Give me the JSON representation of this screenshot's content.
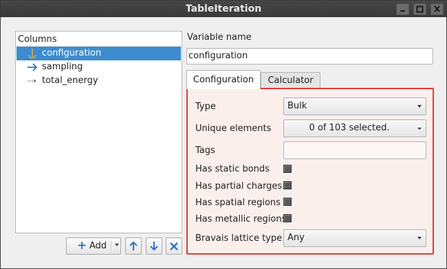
{
  "window": {
    "title": "TableIteration",
    "controls": [
      "minimize",
      "maximize",
      "close"
    ]
  },
  "columns_panel": {
    "header": "Columns",
    "items": [
      {
        "label": "configuration",
        "icon": "anchor-icon",
        "selected": true
      },
      {
        "label": "sampling",
        "icon": "arrow-right-icon",
        "selected": false
      },
      {
        "label": "total_energy",
        "icon": "dashed-arrow-icon",
        "selected": false
      }
    ]
  },
  "toolbar": {
    "add_label": "Add"
  },
  "variable": {
    "label": "Variable name",
    "value": "configuration"
  },
  "tabs": [
    {
      "label": "Configuration",
      "active": true
    },
    {
      "label": "Calculator",
      "active": false
    }
  ],
  "form": {
    "type": {
      "label": "Type",
      "value": "Bulk"
    },
    "unique_elements": {
      "label": "Unique elements",
      "value": "0 of 103 selected."
    },
    "tags": {
      "label": "Tags",
      "value": ""
    },
    "has_static_bonds": {
      "label": "Has static bonds",
      "checked": "indeterminate"
    },
    "has_partial_charges": {
      "label": "Has partial charges",
      "checked": "indeterminate"
    },
    "has_spatial_regions": {
      "label": "Has spatial regions",
      "checked": "indeterminate"
    },
    "has_metallic_regions": {
      "label": "Has metallic regions",
      "checked": "indeterminate"
    },
    "bravais": {
      "label": "Bravais lattice type",
      "value": "Any"
    }
  },
  "colors": {
    "selection": "#3d8ccd",
    "highlight_border": "#e03a33",
    "panel_tint": "#fbefec"
  }
}
